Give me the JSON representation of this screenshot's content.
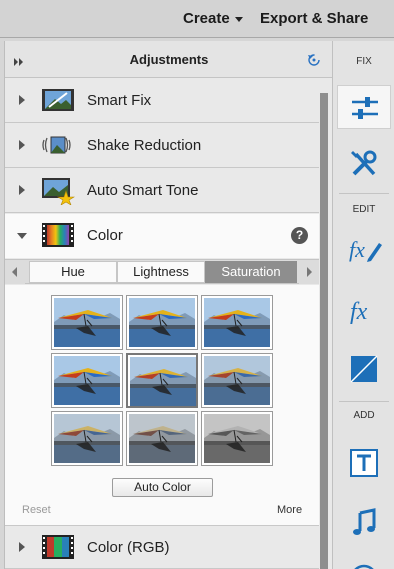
{
  "topbar": {
    "create": "Create",
    "export_share": "Export & Share"
  },
  "panel": {
    "title": "Adjustments"
  },
  "sections": [
    {
      "label": "Smart Fix",
      "icon": "smart-fix-icon"
    },
    {
      "label": "Shake Reduction",
      "icon": "shake-reduction-icon"
    },
    {
      "label": "Auto Smart Tone",
      "icon": "auto-smart-tone-icon"
    },
    {
      "label": "Color",
      "icon": "color-spectrum-icon",
      "expanded": true
    },
    {
      "label": "Color (RGB)",
      "icon": "color-rgb-icon"
    }
  ],
  "color": {
    "help": "?",
    "tabs": [
      "Hue",
      "Lightness",
      "Saturation"
    ],
    "active_tab": "Saturation",
    "auto_button": "Auto Color",
    "reset": "Reset",
    "more": "More",
    "thumbnail_saturation_levels": [
      1.0,
      1.0,
      1.0,
      1.0,
      0.85,
      0.7,
      0.5,
      0.25,
      0.0
    ]
  },
  "toolbar": {
    "fix": "FIX",
    "edit": "EDIT",
    "add": "ADD"
  },
  "colors": {
    "active_tab": "#8e8e8e",
    "tool_blue": "#1d6fb8",
    "thumb_highlight": "#2a6ac4"
  }
}
